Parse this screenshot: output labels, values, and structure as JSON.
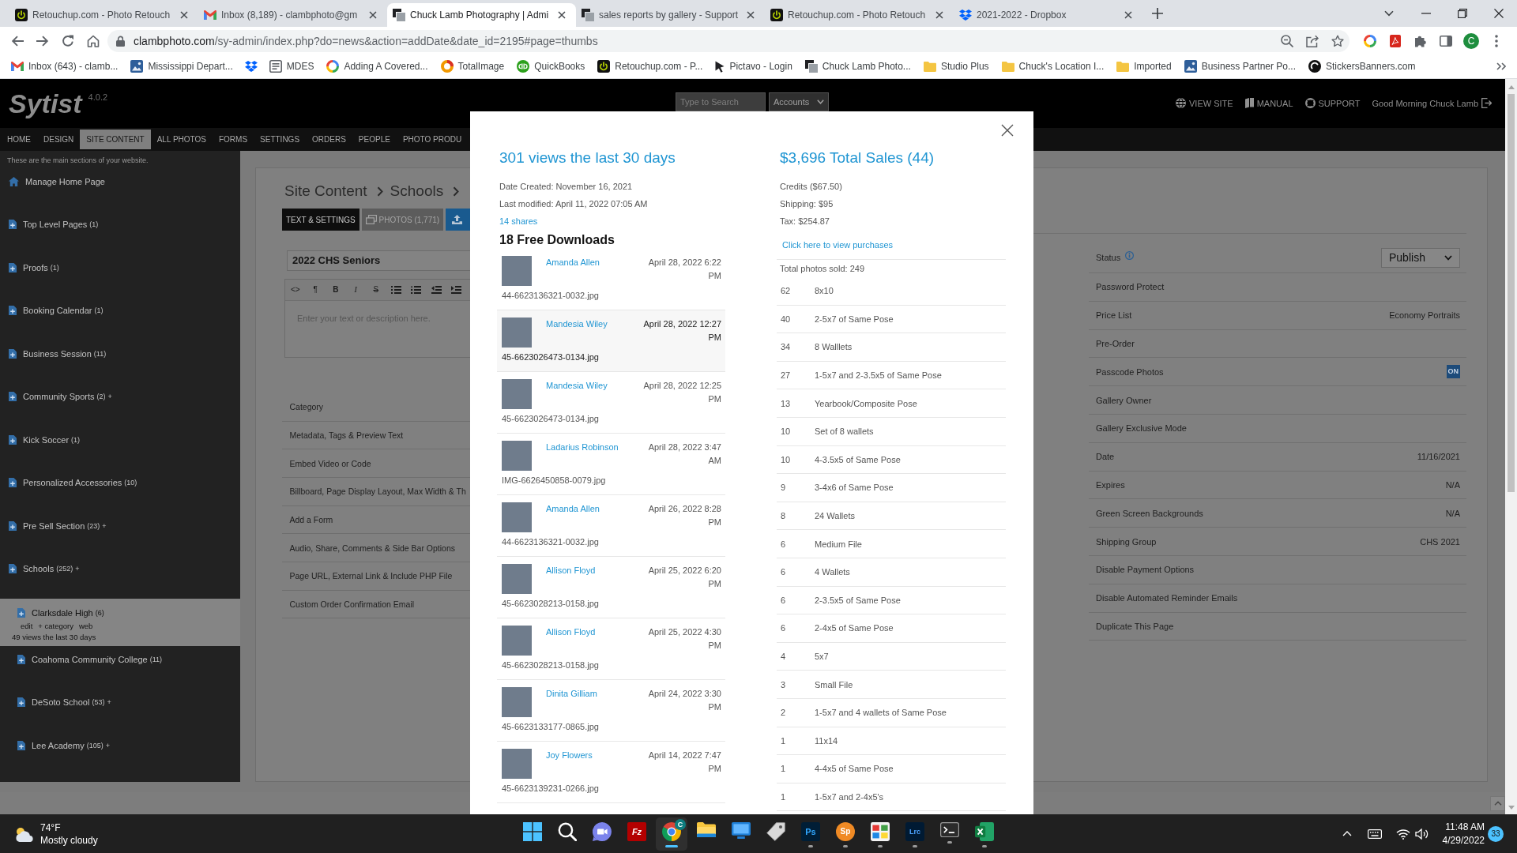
{
  "browser": {
    "tabs": [
      {
        "title": "Retouchup.com - Photo Retouch",
        "selected": false
      },
      {
        "title": "Inbox (8,189) - clambphoto@gm",
        "selected": false
      },
      {
        "title": "Chuck Lamb Photography | Admi",
        "selected": true
      },
      {
        "title": "sales reports by gallery - Support",
        "selected": false
      },
      {
        "title": "Retouchup.com - Photo Retouch",
        "selected": false
      },
      {
        "title": "2021-2022 - Dropbox",
        "selected": false
      }
    ],
    "address": {
      "domain": "clambphoto.com",
      "path": "/sy-admin/index.php?do=news&action=addDate&date_id=2195#page=thumbs"
    },
    "profile": "C",
    "bookmarks": [
      {
        "kind": "link",
        "label": "Inbox (643) - clamb..."
      },
      {
        "kind": "link",
        "label": "Mississippi Depart..."
      },
      {
        "kind": "icon"
      },
      {
        "kind": "link",
        "label": "MDES"
      },
      {
        "kind": "link",
        "label": "Adding A Covered..."
      },
      {
        "kind": "link",
        "label": "TotalImage"
      },
      {
        "kind": "link",
        "label": "QuickBooks"
      },
      {
        "kind": "link",
        "label": "Retouchup.com - P..."
      },
      {
        "kind": "link",
        "label": "Pictavo - Login"
      },
      {
        "kind": "link",
        "label": "Chuck Lamb Photo..."
      },
      {
        "kind": "link",
        "label": "Studio Plus"
      },
      {
        "kind": "link",
        "label": "Chuck's Location I..."
      },
      {
        "kind": "link",
        "label": "Imported"
      },
      {
        "kind": "link",
        "label": "Business Partner Po..."
      },
      {
        "kind": "link",
        "label": "StickersBanners.com"
      }
    ]
  },
  "header": {
    "logo": "Sytist",
    "version": "4.0.2",
    "search": {
      "placeholder": "Type to Search"
    },
    "accounts": "Accounts",
    "links": [
      "VIEW SITE",
      "MANUAL",
      "SUPPORT"
    ],
    "greeting": "Good Morning Chuck Lamb"
  },
  "nav": [
    {
      "label": "HOME",
      "selected": false
    },
    {
      "label": "DESIGN",
      "selected": false
    },
    {
      "label": "SITE CONTENT",
      "selected": true
    },
    {
      "label": "ALL PHOTOS",
      "selected": false
    },
    {
      "label": "FORMS",
      "selected": false
    },
    {
      "label": "SETTINGS",
      "selected": false
    },
    {
      "label": "ORDERS",
      "selected": false
    },
    {
      "label": "PEOPLE",
      "selected": false
    },
    {
      "label": "PHOTO PRODU",
      "selected": false
    }
  ],
  "sidebar": {
    "note": "These are the main sections of your website.",
    "items": [
      {
        "kind": "home",
        "label": "Manage Home Page",
        "selected": false
      },
      {
        "kind": "page",
        "label": "Top Level Pages",
        "count": "(1)",
        "selected": false
      },
      {
        "kind": "page",
        "label": "Proofs",
        "count": "(1)",
        "selected": false
      },
      {
        "kind": "page",
        "label": "Booking Calendar",
        "count": "(1)",
        "selected": false
      },
      {
        "kind": "page",
        "label": "Business Session",
        "count": "(11)",
        "selected": false
      },
      {
        "kind": "page",
        "label": "Community Sports",
        "count": "(2)",
        "suffix": "+",
        "selected": false
      },
      {
        "kind": "page",
        "label": "Kick Soccer",
        "count": "(1)",
        "selected": false
      },
      {
        "kind": "page",
        "label": "Personalized Accessories",
        "count": "(10)",
        "selected": false
      },
      {
        "kind": "page",
        "label": "Pre Sell Section",
        "count": "(23)",
        "suffix": "+",
        "selected": false
      },
      {
        "kind": "page",
        "label": "Schools",
        "count": "(252)",
        "suffix": "+",
        "selected": false,
        "children": [
          {
            "kind": "page",
            "label": "Clarksdale High",
            "count": "(6)",
            "selected": true,
            "actions": [
              "edit",
              "+ category",
              "web"
            ],
            "views": "49 views the last 30 days"
          },
          {
            "kind": "page",
            "label": "Coahoma Community College",
            "count": "(11)",
            "selected": false
          },
          {
            "kind": "page",
            "label": "DeSoto School",
            "count": "(53)",
            "suffix": "+",
            "selected": false
          },
          {
            "kind": "page",
            "label": "Lee Academy",
            "count": "(105)",
            "suffix": "+",
            "selected": false
          }
        ]
      }
    ]
  },
  "editor": {
    "breadcrumb": [
      "Site Content",
      "Schools"
    ],
    "tabs": [
      {
        "label": "TEXT & SETTINGS",
        "selected": true
      },
      {
        "label": "PHOTOS (1,771)",
        "selected": false
      }
    ],
    "actions": [
      {
        "kind": "upload"
      }
    ],
    "title": {
      "value": "2022 CHS Seniors"
    },
    "toolbar": [
      {
        "kind": "code",
        "label": "<>"
      },
      {
        "kind": "paragraph",
        "label": "¶"
      },
      {
        "kind": "bold",
        "label": "B"
      },
      {
        "kind": "italic",
        "label": "I"
      },
      {
        "kind": "strike",
        "label": "S"
      },
      {
        "kind": "bullets"
      },
      {
        "kind": "numbers"
      },
      {
        "kind": "outdent"
      },
      {
        "kind": "indent"
      }
    ],
    "description": {
      "placeholder": "Enter your text or description here."
    },
    "sections": [
      "Category",
      "Metadata, Tags & Preview Text",
      "Embed Video or Code",
      "Billboard, Page Display Layout, Max Width & Th",
      "Add a Form",
      "Audio, Share, Comments & Side Bar Options",
      "Page URL, External Link & Include PHP File",
      "Custom Order Confirmation Email"
    ]
  },
  "settings": [
    {
      "kind": "select",
      "label": "Status",
      "info": true,
      "value": "Publish"
    },
    {
      "kind": "plain",
      "label": "Password Protect"
    },
    {
      "kind": "text",
      "label": "Price List",
      "value": "Economy Portraits"
    },
    {
      "kind": "plain",
      "label": "Pre-Order"
    },
    {
      "kind": "toggle",
      "label": "Passcode Photos",
      "value": "ON",
      "on": true
    },
    {
      "kind": "plain",
      "label": "Gallery Owner"
    },
    {
      "kind": "plain",
      "label": "Gallery Exclusive Mode"
    },
    {
      "kind": "text",
      "label": "Date",
      "value": "11/16/2021"
    },
    {
      "kind": "text",
      "label": "Expires",
      "value": "N/A"
    },
    {
      "kind": "text",
      "label": "Green Screen Backgrounds",
      "value": "N/A"
    },
    {
      "kind": "text",
      "label": "Shipping Group",
      "value": "CHS 2021"
    },
    {
      "kind": "plain",
      "label": "Disable Payment Options"
    },
    {
      "kind": "plain",
      "label": "Disable Automated Reminder Emails"
    },
    {
      "kind": "plain",
      "label": "Duplicate This Page"
    }
  ],
  "modal": {
    "views": "301 views the last 30 days",
    "date_created": "Date Created: November 16, 2021",
    "last_modified": "Last modified: April 11, 2022 07:05 AM",
    "shares": "14 shares",
    "downloads_title": "18 Free Downloads",
    "downloads": [
      {
        "name": "Amanda Allen",
        "date": "April 28, 2022 6:22 PM",
        "file": "44-6623136321-0032.jpg",
        "selected": false
      },
      {
        "name": "Mandesia Wiley",
        "date": "April 28, 2022 12:27 PM",
        "file": "45-6623026473-0134.jpg",
        "selected": true
      },
      {
        "name": "Mandesia Wiley",
        "date": "April 28, 2022 12:25 PM",
        "file": "45-6623026473-0134.jpg",
        "selected": false
      },
      {
        "name": "Ladarius Robinson",
        "date": "April 28, 2022 3:47 AM",
        "file": "IMG-6626450858-0079.jpg",
        "selected": false
      },
      {
        "name": "Amanda Allen",
        "date": "April 26, 2022 8:28 PM",
        "file": "44-6623136321-0032.jpg",
        "selected": false
      },
      {
        "name": "Allison Floyd",
        "date": "April 25, 2022 6:20 PM",
        "file": "45-6623028213-0158.jpg",
        "selected": false
      },
      {
        "name": "Allison Floyd",
        "date": "April 25, 2022 4:30 PM",
        "file": "45-6623028213-0158.jpg",
        "selected": false
      },
      {
        "name": "Dinita Gilliam",
        "date": "April 24, 2022 3:30 PM",
        "file": "45-6623133177-0865.jpg",
        "selected": false
      },
      {
        "name": "Joy Flowers",
        "date": "April 14, 2022 7:47 PM",
        "file": "45-6623139231-0266.jpg",
        "selected": false
      }
    ],
    "sales": "$3,696 Total Sales (44)",
    "credits": "Credits ($67.50)",
    "shipping": "Shipping: $95",
    "tax": "Tax: $254.87",
    "purchases_link": "Click here to view purchases",
    "total_sold": "Total photos sold: 249",
    "products": [
      {
        "qty": "62",
        "item": "8x10"
      },
      {
        "qty": "40",
        "item": "2-5x7 of Same Pose"
      },
      {
        "qty": "34",
        "item": "8 Walllets"
      },
      {
        "qty": "27",
        "item": "1-5x7 and 2-3.5x5 of Same Pose"
      },
      {
        "qty": "13",
        "item": "Yearbook/Composite Pose"
      },
      {
        "qty": "10",
        "item": "Set of 8 wallets"
      },
      {
        "qty": "10",
        "item": "4-3.5x5 of Same Pose"
      },
      {
        "qty": "9",
        "item": "3-4x6 of Same Pose"
      },
      {
        "qty": "8",
        "item": "24 Wallets"
      },
      {
        "qty": "6",
        "item": "Medium File"
      },
      {
        "qty": "6",
        "item": "4 Wallets"
      },
      {
        "qty": "6",
        "item": "2-3.5x5 of Same Pose"
      },
      {
        "qty": "6",
        "item": "2-4x5 of Same Pose"
      },
      {
        "qty": "4",
        "item": "5x7"
      },
      {
        "qty": "3",
        "item": "Small File"
      },
      {
        "qty": "2",
        "item": "1-5x7 and 4 wallets of Same Pose"
      },
      {
        "qty": "1",
        "item": "11x14"
      },
      {
        "qty": "1",
        "item": "4-4x5 of Same Pose"
      },
      {
        "qty": "1",
        "item": "1-5x7 and 2-4x5's"
      }
    ]
  },
  "taskbar": {
    "weather": {
      "temperature": "74°F",
      "condition": "Mostly cloudy"
    },
    "apps": [
      {
        "kind": "start",
        "selected": false,
        "running": false
      },
      {
        "kind": "search",
        "selected": false,
        "running": false
      },
      {
        "kind": "chat",
        "selected": false,
        "running": false
      },
      {
        "kind": "fz",
        "label": "Fz",
        "selected": false,
        "running": false
      },
      {
        "kind": "chrome",
        "badge": "C",
        "selected": true,
        "running": true
      },
      {
        "kind": "explorer",
        "selected": false,
        "running": false
      },
      {
        "kind": "monitor",
        "selected": false,
        "running": false
      },
      {
        "kind": "tag",
        "selected": false,
        "running": false
      },
      {
        "kind": "ps",
        "label": "Ps",
        "selected": false,
        "running": true
      },
      {
        "kind": "sp",
        "label": "Sp",
        "selected": false,
        "running": true
      },
      {
        "kind": "colorful",
        "selected": false,
        "running": true
      },
      {
        "kind": "lrc",
        "label": "Lrc",
        "selected": false,
        "running": true
      },
      {
        "kind": "terminal",
        "selected": false,
        "running": true
      },
      {
        "kind": "excel",
        "selected": false,
        "running": true
      }
    ],
    "time": "11:48 AM",
    "date": "4/29/2022",
    "notifications": "33"
  }
}
